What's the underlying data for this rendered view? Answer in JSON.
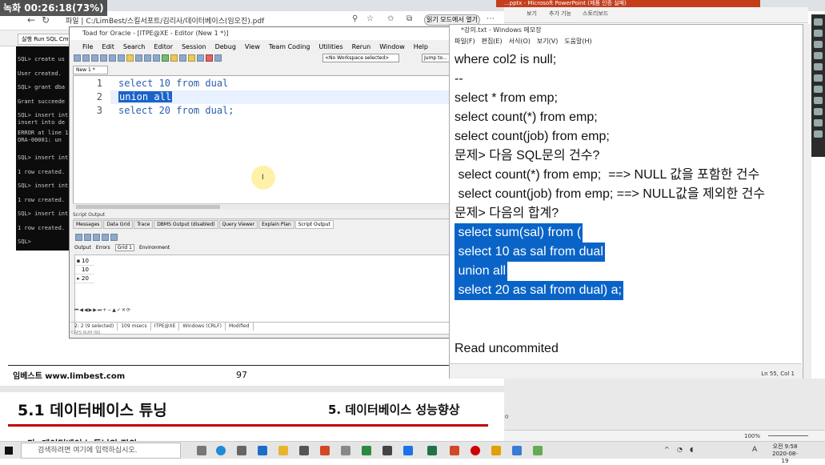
{
  "recording": {
    "badge": "녹화 00:26:18(73%)"
  },
  "browser": {
    "url": "파일 | C:/LimBest/스킬서포트/김리사/데이터베이스(임오진).pdf",
    "zoom_pill": "읽기 모드에서 열기"
  },
  "ppt": {
    "title": "...pptx - Microsoft PowerPoint (제품 인증 실패)",
    "menu": [
      "보기",
      "추가 기능",
      "스토리보드"
    ],
    "zoom": "100%",
    "snippet": "ㅇ"
  },
  "pdf": {
    "footer_brand": "임베스트 www.limbest.com",
    "footer_page": "97",
    "heading_left": "5.1 데이터베이스 튜닝",
    "heading_right": "5. 데이터베이스 성능향상",
    "subheading": "가. 데이터베이스 튜닝의 정의"
  },
  "cmd": {
    "tab": "실행 Run SQL Cmd",
    "lines": [
      "SQL> create us",
      "User created.",
      "SQL> grant dba",
      "Grant succeede",
      "SQL> insert int",
      "insert into de",
      "ERROR at line 1",
      "ORA-00001: un",
      "SQL> insert int",
      "1 row created.",
      "SQL> insert int",
      "1 row created.",
      "SQL> insert int",
      "1 row created.",
      "SQL>"
    ]
  },
  "toad": {
    "title": "Toad for Oracle - [ITPE@XE - Editor (New 1 *)]",
    "menu": [
      "File",
      "Edit",
      "Search",
      "Editor",
      "Session",
      "Debug",
      "View",
      "Team Coding",
      "Utilities",
      "Rerun",
      "Window",
      "Help"
    ],
    "workspace": "<No Workspace selected>",
    "jump": "Jump to...",
    "editor_tab": "New 1 *",
    "editor_lines": [
      {
        "num": "1",
        "text": "select 10 from dual",
        "selected": false
      },
      {
        "num": "2",
        "text": "union all",
        "selected": true
      },
      {
        "num": "3",
        "text": "select 20 from dual;",
        "selected": false
      }
    ],
    "panel_title": "Script Output",
    "panel_tabs": [
      "Messages",
      "Data Grid",
      "Trace",
      "DBMS Output (disabled)",
      "Query Viewer",
      "Explain Plan",
      "Script Output"
    ],
    "grid_tabs": [
      "Output",
      "Errors",
      "Grid 1",
      "Environment"
    ],
    "grid_values": [
      "10",
      "10",
      "20"
    ],
    "status": [
      "2: 2 (9 selected)",
      "109 msecs",
      "ITPE@XE",
      "Windows (CRLF)",
      "Modified"
    ],
    "status2": "CAPS NUM INS"
  },
  "notepad": {
    "title": "*강의.txt - Windows 메모장",
    "menu": [
      "파일(F)",
      "편집(E)",
      "서식(O)",
      "보기(V)",
      "도움말(H)"
    ],
    "lines": [
      {
        "text": "where col2 is null;",
        "selected": false
      },
      {
        "text": "--",
        "selected": false
      },
      {
        "text": "select * from emp;",
        "selected": false
      },
      {
        "text": "select count(*) from emp;",
        "selected": false
      },
      {
        "text": "select count(job) from emp;",
        "selected": false
      },
      {
        "text": "문제> 다음 SQL문의 건수?",
        "selected": false
      },
      {
        "text": " select count(*) from emp;  ==> NULL 값을 포함한 건수",
        "selected": false
      },
      {
        "text": " select count(job) from emp; ==> NULL값을 제외한 건수",
        "selected": false
      },
      {
        "text": "문제> 다음의 합계?",
        "selected": false
      },
      {
        "text": " select sum(sal) from (",
        "selected": true
      },
      {
        "text": " select 10 as sal from dual",
        "selected": true
      },
      {
        "text": " union all",
        "selected": true
      },
      {
        "text": " select 20 as sal from dual) a;",
        "selected": true
      },
      {
        "text": "",
        "selected": false
      },
      {
        "text": "",
        "selected": false
      },
      {
        "text": "Read uncommited",
        "selected": false
      }
    ],
    "status": "Ln 55, Col 1"
  },
  "taskbar": {
    "search_placeholder": "검색하려면 여기에 입력하십시오.",
    "ime": "A",
    "clock_time": "오전 9:58",
    "clock_date": "2020-08-19"
  },
  "colors": {
    "selection": "#0a64c8",
    "code_keyword": "#2b5eb0",
    "ppt_red": "#c43e1c"
  }
}
